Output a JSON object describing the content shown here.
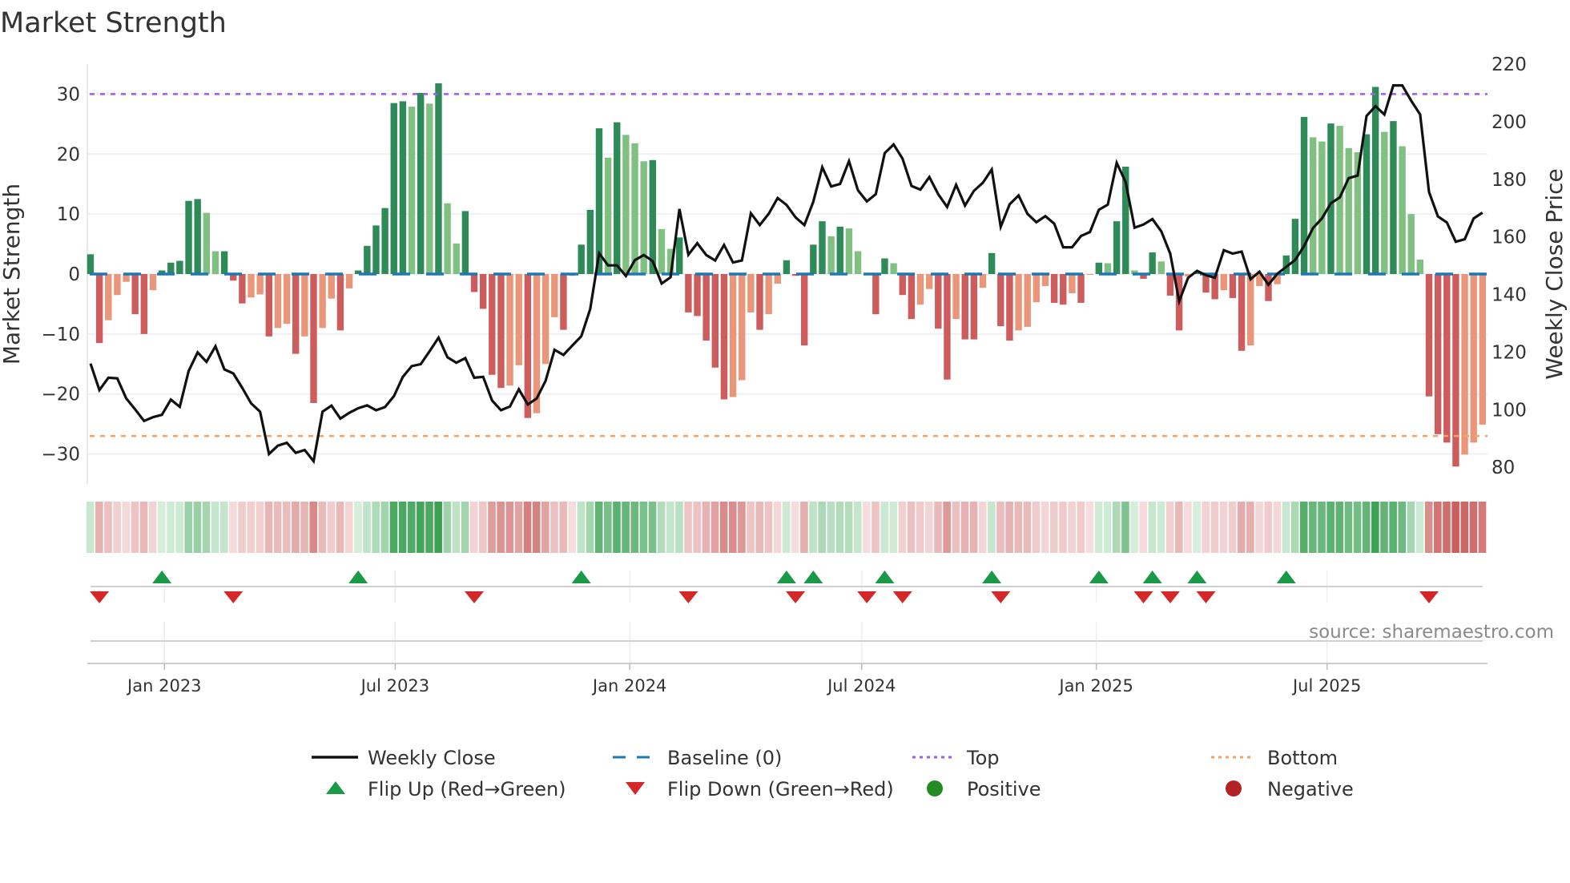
{
  "chart_data": {
    "type": "bar",
    "title": "Market Strength",
    "ylabel_left": "Market Strength",
    "ylabel_right": "Weekly Close Price",
    "ylim_left": [
      -35,
      35
    ],
    "ylim_right": [
      74.2,
      220
    ],
    "yticks_left": [
      {
        "value": 30,
        "label": "30"
      },
      {
        "value": 20,
        "label": "20"
      },
      {
        "value": 10,
        "label": "10"
      },
      {
        "value": 0,
        "label": "0"
      },
      {
        "value": -10,
        "label": "−10"
      },
      {
        "value": -20,
        "label": "−20"
      },
      {
        "value": -30,
        "label": "−30"
      }
    ],
    "yticks_right": [
      {
        "value": 220,
        "label": "220"
      },
      {
        "value": 200,
        "label": "200"
      },
      {
        "value": 180,
        "label": "180"
      },
      {
        "value": 160,
        "label": "160"
      },
      {
        "value": 140,
        "label": "140"
      },
      {
        "value": 120,
        "label": "120"
      },
      {
        "value": 100,
        "label": "100"
      },
      {
        "value": 80,
        "label": "80"
      }
    ],
    "x_start": "2022-11-04",
    "x_frequency": "weekly",
    "xticks": [
      {
        "label": "Jan 2023",
        "date": "2023-01-01"
      },
      {
        "label": "Jul 2023",
        "date": "2023-07-01"
      },
      {
        "label": "Jan 2024",
        "date": "2024-01-01"
      },
      {
        "label": "Jul 2024",
        "date": "2024-07-01"
      },
      {
        "label": "Jan 2025",
        "date": "2025-01-01"
      },
      {
        "label": "Jul 2025",
        "date": "2025-07-01"
      }
    ],
    "reference_lines": {
      "top": 30,
      "bottom": -27,
      "baseline": 0
    },
    "strength": [
      3.3,
      -11.5,
      -7.7,
      -3.5,
      -1.3,
      -6.7,
      -10,
      -2.7,
      0.6,
      1.9,
      2.2,
      12.2,
      12.5,
      10.2,
      3.8,
      3.8,
      -1.1,
      -4.9,
      -3.9,
      -3.4,
      -10.4,
      -9,
      -8.3,
      -13.3,
      -10.4,
      -21.5,
      -9,
      -4.1,
      -9.4,
      -2.4,
      0.6,
      4.7,
      8.1,
      11,
      28.5,
      28.8,
      27.9,
      30.2,
      28.4,
      31.8,
      11.8,
      5.1,
      10.5,
      -3,
      -5.8,
      -16.8,
      -19,
      -18.6,
      -15.2,
      -24,
      -23.2,
      -15,
      -7.2,
      -9.3,
      -0.3,
      4.9,
      10.7,
      24.3,
      19.4,
      25.3,
      23.2,
      21.8,
      18.8,
      19,
      7.5,
      4.2,
      6.1,
      -6.4,
      -7,
      -11.1,
      -15.6,
      -20.9,
      -20.5,
      -17.7,
      -6.4,
      -9.3,
      -6.7,
      -1.6,
      2.3,
      -0.3,
      -11.9,
      4.9,
      8.8,
      6.3,
      7.9,
      7.6,
      3.8,
      -0.2,
      -6.7,
      2.6,
      1.8,
      -3.5,
      -7.5,
      -5.1,
      -2.5,
      -9.1,
      -17.6,
      -7.5,
      -10.9,
      -10.9,
      -2.3,
      3.5,
      -8.7,
      -11.1,
      -9.4,
      -8.8,
      -4.7,
      -2,
      -4.8,
      -5.1,
      -3.2,
      -4.8,
      -0.1,
      1.9,
      1.8,
      8.8,
      17.9,
      0.6,
      -0.8,
      3.6,
      2.1,
      -3.6,
      -9.4,
      -0.4,
      0.3,
      -3.1,
      -4.2,
      -2.7,
      -4,
      -12.8,
      -11.9,
      -2,
      -4.5,
      -1.7,
      3.1,
      9.2,
      26.2,
      22.8,
      22.1,
      25.1,
      24.7,
      21,
      20.3,
      23.3,
      31.2,
      23.7,
      25.5,
      21.3,
      10,
      2.4,
      -20.4,
      -26.7,
      -28.1,
      -32.1,
      -30.1,
      -28.1,
      -25.1
    ],
    "weekly_close": [
      116,
      106.8,
      111.1,
      110.9,
      103.9,
      100.1,
      96.1,
      97.4,
      98.2,
      103.5,
      101,
      113.4,
      119.9,
      116.6,
      122,
      114,
      112.6,
      107.6,
      102.2,
      99.3,
      84.6,
      87.5,
      88.5,
      85,
      86,
      82.1,
      99.3,
      101.4,
      96.9,
      98.9,
      100.5,
      101.5,
      99.8,
      100.9,
      104.7,
      111.4,
      115.1,
      115.8,
      120.3,
      125,
      118.2,
      116.3,
      117.9,
      111.1,
      111.4,
      103.2,
      99.8,
      101.1,
      107.1,
      101.8,
      103.9,
      110,
      120.8,
      119,
      122.3,
      125.5,
      134.9,
      154.3,
      150.1,
      150.1,
      146.4,
      151.9,
      153.7,
      151.6,
      143.8,
      146,
      169.7,
      153.8,
      157.8,
      153.7,
      151.8,
      157.2,
      151.1,
      151.8,
      168.2,
      164.1,
      168,
      173.5,
      171.1,
      166.8,
      164.1,
      172.2,
      184.2,
      177.5,
      178.4,
      186.3,
      176.2,
      172.3,
      174.8,
      189.1,
      192.1,
      187.2,
      177.7,
      176.4,
      180.8,
      174.8,
      170.4,
      178.1,
      170.9,
      176,
      178.8,
      183.4,
      163.5,
      171.3,
      174.4,
      168,
      165.1,
      167.2,
      164.6,
      156.4,
      156.4,
      160.3,
      161.7,
      169.4,
      171.2,
      185.7,
      179.1,
      163.2,
      164.3,
      166.2,
      161.9,
      154.2,
      137.6,
      145.8,
      148.2,
      146.7,
      145.8,
      155.4,
      154.2,
      154.9,
      145.3,
      147.9,
      143.4,
      147.2,
      149.6,
      152,
      156.8,
      163.1,
      166.4,
      171.7,
      173.7,
      180.4,
      181.3,
      202,
      205.4,
      202.5,
      212.6,
      212.6,
      207.3,
      202.5,
      175.6,
      167.1,
      165,
      158.3,
      159.2,
      166.4,
      168.4
    ],
    "legend_placement": "bottom-center",
    "legend": [
      {
        "label": "Weekly Close",
        "symbol": "line",
        "color": "#111111"
      },
      {
        "label": "Baseline (0)",
        "symbol": "dash",
        "color": "#1f77b4"
      },
      {
        "label": "Top",
        "symbol": "dot",
        "color": "#9b5de5"
      },
      {
        "label": "Bottom",
        "symbol": "dot",
        "color": "#f4a261"
      },
      {
        "label": "Flip Up (Red→Green)",
        "symbol": "triangle-up",
        "color": "#1a9a46"
      },
      {
        "label": "Flip Down (Green→Red)",
        "symbol": "triangle-down",
        "color": "#d62728"
      },
      {
        "label": "Positive",
        "symbol": "circle",
        "color": "#228b22"
      },
      {
        "label": "Negative",
        "symbol": "circle",
        "color": "#b22222"
      }
    ],
    "source": "source: sharemaestro.com"
  },
  "colors": {
    "pos_strong": "#2e8b57",
    "pos_weak": "#80c080",
    "neg_strong": "#cd5c5c",
    "neg_weak": "#e9967a",
    "baseline": "#1f77b4",
    "top": "#9b5de5",
    "bottom": "#f4a261",
    "line": "#111111",
    "flip_up": "#1a9a46",
    "flip_down": "#d62728"
  }
}
